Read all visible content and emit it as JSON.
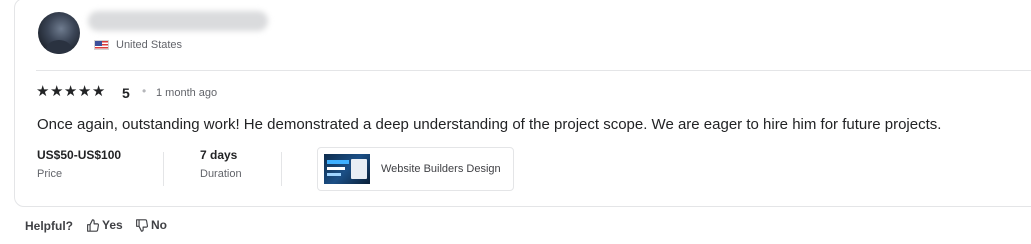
{
  "reviewer": {
    "country": "United States",
    "flag_icon": "us-flag-icon"
  },
  "review": {
    "stars": 5,
    "rating_label": "5",
    "date": "1 month ago",
    "comment": "Once again, outstanding work! He demonstrated a deep understanding of the project scope. We are eager to hire him for future projects."
  },
  "meta": {
    "price_value": "US$50-US$100",
    "price_label": "Price",
    "duration_value": "7 days",
    "duration_label": "Duration"
  },
  "gig": {
    "title": "Website Builders Design"
  },
  "feedback": {
    "helpful_label": "Helpful?",
    "yes_label": "Yes",
    "no_label": "No"
  }
}
